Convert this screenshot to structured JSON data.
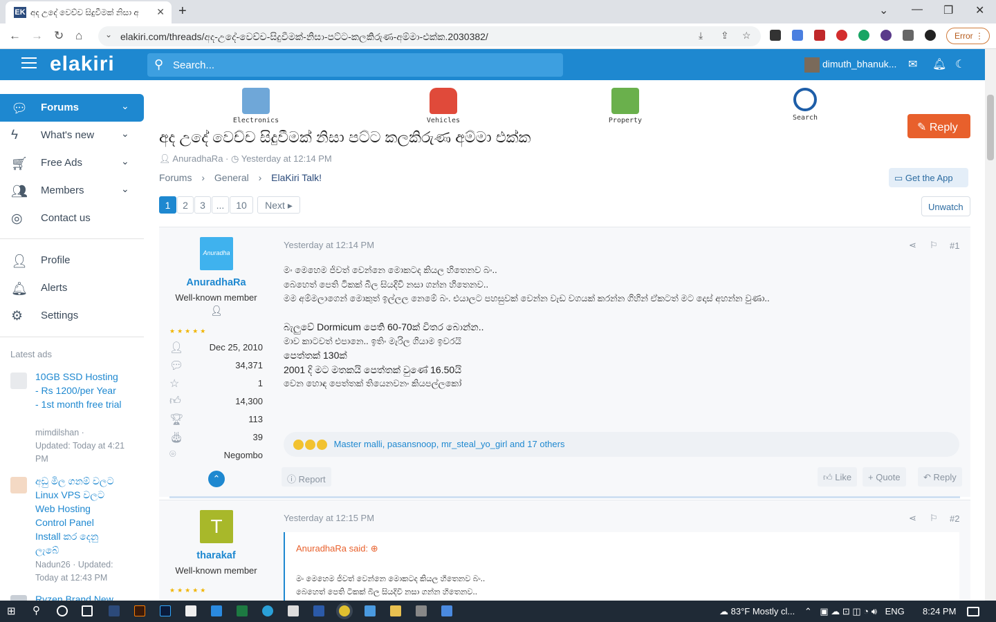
{
  "browser": {
    "tab_title": "අද උදේ වෙච්ච සිදුවීමක් නිසා අ",
    "tab_favicon": "EK",
    "url": "elakiri.com/threads/අද-උදේ-වෙච්ච-සිදුවීමක්-නිසා-පට්ට-කලකිරුණ-අම්මා-එක්ක.2030382/",
    "error_label": "Error"
  },
  "header": {
    "logo": "elakiri",
    "search_placeholder": "Search...",
    "username": "dimuth_bhanuk..."
  },
  "sidebar": {
    "nav": [
      {
        "label": "Forums",
        "icon": "forums-icon"
      },
      {
        "label": "What's new",
        "icon": "bolt-icon"
      },
      {
        "label": "Free Ads",
        "icon": "cart-icon"
      },
      {
        "label": "Members",
        "icon": "members-icon"
      },
      {
        "label": "Contact us",
        "icon": "contact-icon"
      }
    ],
    "account": [
      {
        "label": "Profile",
        "icon": "user-icon"
      },
      {
        "label": "Alerts",
        "icon": "bell-icon"
      },
      {
        "label": "Settings",
        "icon": "gear-icon"
      }
    ],
    "latest_ads_title": "Latest ads",
    "ads": [
      {
        "title": "10GB SSD Hosting - Rs 1200/per Year - 1st month free trial",
        "author": "mimdilshan ·",
        "updated": "Updated: Today at 4:21 PM"
      },
      {
        "title": "අඩු මිල ගනම් වලට Linux VPS වලට Web Hosting Control Panel Install කර දෙනු ලැබේ",
        "author": "Nadun26 · Updated:",
        "updated": "Today at 12:43 PM"
      },
      {
        "title": "Ryzen Brand New",
        "author": "",
        "updated": ""
      }
    ]
  },
  "categories": [
    {
      "label": "Electronics"
    },
    {
      "label": "Vehicles"
    },
    {
      "label": "Property"
    },
    {
      "label": "Search"
    }
  ],
  "thread": {
    "title": "අද උදේ වෙච්ච සිදුවීමක් නිසා පට්ට කලකිරුණ අම්මා එක්ක",
    "author": "AnuradhaRa",
    "time": "Yesterday at 12:14 PM",
    "breadcrumbs": [
      "Forums",
      "General",
      "ElaKiri Talk!"
    ],
    "reply_label": "Reply",
    "app_label": "Get the App",
    "unwatch_label": "Unwatch",
    "pages": [
      "1",
      "2",
      "3",
      "...",
      "10"
    ],
    "next_label": "Next"
  },
  "posts": [
    {
      "user": "AnuradhaRa",
      "avatar_text": "Anuradha",
      "rank": "Well-known member",
      "stats": [
        {
          "icon": "user-icon",
          "value": "Dec 25, 2010"
        },
        {
          "icon": "messages-icon",
          "value": "34,371"
        },
        {
          "icon": "star-icon",
          "value": "1"
        },
        {
          "icon": "thumb-icon",
          "value": "14,300"
        },
        {
          "icon": "trophy-icon",
          "value": "113"
        },
        {
          "icon": "cake-icon",
          "value": "39"
        },
        {
          "icon": "location-icon",
          "value": "Negombo"
        }
      ],
      "time": "Yesterday at 12:14 PM",
      "number": "#1",
      "lines": [
        "මං මෙහෙම ජිවත් වෙන්නෙ මොකටද කියල හිතෙනව බං..",
        "බෙහෙත් පෙති ටිකක් බීල සියදිවි නසා ගන්න හිතෙනව..",
        "මම අම්මලාගෙන් මොකුත් ඉල්ලල නෙමේ බං. එයාලට පහසුවක් වෙන්න වැඩ වගයක් කරන්න ගිහින් ඒකටත් මට දොස් අහන්න වුණා..",
        "",
        "බැලුවේ Dormicum පෙති 60-70ක් විතර බොන්න..",
        "මාව කාටවත් එපානෙ.. ඉතිං මැරිල ගියාම ඉවරයි",
        "පෙත්තක් 130ක්",
        "2001 දි මට මතකයි පෙත්තක් වුණේ 16.50යි",
        "වෙන හොඳ පෙත්තක් තියෙනවනං කියපල්ලකෝ"
      ],
      "reactions": "Master malli, pasansnoop, mr_steal_yo_girl and 17 others",
      "report_label": "Report",
      "like_label": "Like",
      "quote_label": "Quote",
      "reply_label": "Reply"
    },
    {
      "user": "tharakaf",
      "avatar_text": "T",
      "rank": "Well-known member",
      "time": "Yesterday at 12:15 PM",
      "number": "#2",
      "quote_author": "AnuradhaRa said:",
      "quote_lines": [
        "මං මෙහෙම ජිවත් වෙන්නෙ මොකටද කියල හිතෙනව බං..",
        "බෙහෙත් පෙති ටිකක් බීල සියදිවි නසා ගන්න හිතෙනව.."
      ]
    }
  ],
  "taskbar": {
    "weather": "83°F  Mostly cl...",
    "lang": "ENG",
    "clock": "8:24 PM"
  },
  "colors": {
    "brand_blue": "#1e88d0",
    "reply_orange": "#e8602c",
    "star_gold": "#f0b400"
  }
}
